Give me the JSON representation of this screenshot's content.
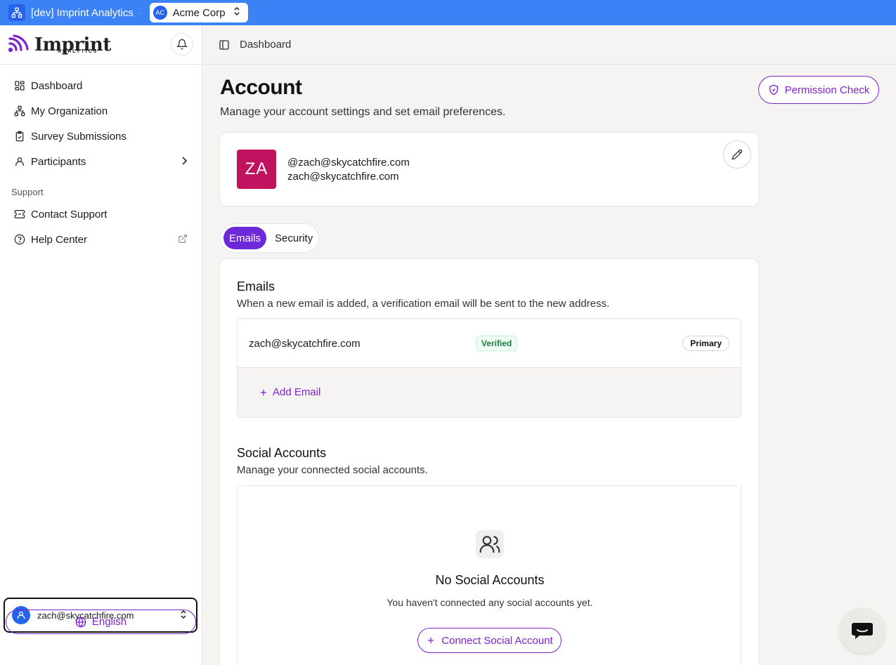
{
  "topbar": {
    "app_title": "[dev] Imprint Analytics",
    "separator": "·",
    "org_initials": "AC",
    "org_name": "Acme Corp"
  },
  "sidebar": {
    "logo_text": "Imprint",
    "logo_sub": "ANALYTICS",
    "items": [
      {
        "label": "Dashboard",
        "icon": "dashboard-icon"
      },
      {
        "label": "My Organization",
        "icon": "organization-icon"
      },
      {
        "label": "Survey Submissions",
        "icon": "clipboard-check-icon"
      },
      {
        "label": "Participants",
        "icon": "user-icon"
      }
    ],
    "support_label": "Support",
    "support_items": [
      {
        "label": "Contact Support",
        "icon": "ticket-icon"
      },
      {
        "label": "Help Center",
        "icon": "help-circle-icon"
      }
    ],
    "user_email": "zach@skycatchfire.com",
    "language": "English"
  },
  "header": {
    "breadcrumb": "Dashboard"
  },
  "page": {
    "title": "Account",
    "subtitle": "Manage your account settings and set email preferences.",
    "permission_button": "Permission Check"
  },
  "profile": {
    "initials": "ZA",
    "handle": "@zach@skycatchfire.com",
    "email": "zach@skycatchfire.com"
  },
  "tabs": [
    {
      "label": "Emails",
      "active": true
    },
    {
      "label": "Security",
      "active": false
    }
  ],
  "emails": {
    "title": "Emails",
    "description": "When a new email is added, a verification email will be sent to the new address.",
    "list": [
      {
        "address": "zach@skycatchfire.com",
        "status": "Verified",
        "tag": "Primary"
      }
    ],
    "add_label": "Add Email"
  },
  "social": {
    "title": "Social Accounts",
    "description": "Manage your connected social accounts.",
    "empty_title": "No Social Accounts",
    "empty_desc": "You haven't connected any social accounts yet.",
    "connect_label": "Connect Social Account"
  },
  "colors": {
    "topbar": "#3b82f6",
    "accent": "#7e22ce",
    "tab_active": "#6d28d9",
    "avatar": "#c0125f",
    "verified": "#15803d"
  }
}
